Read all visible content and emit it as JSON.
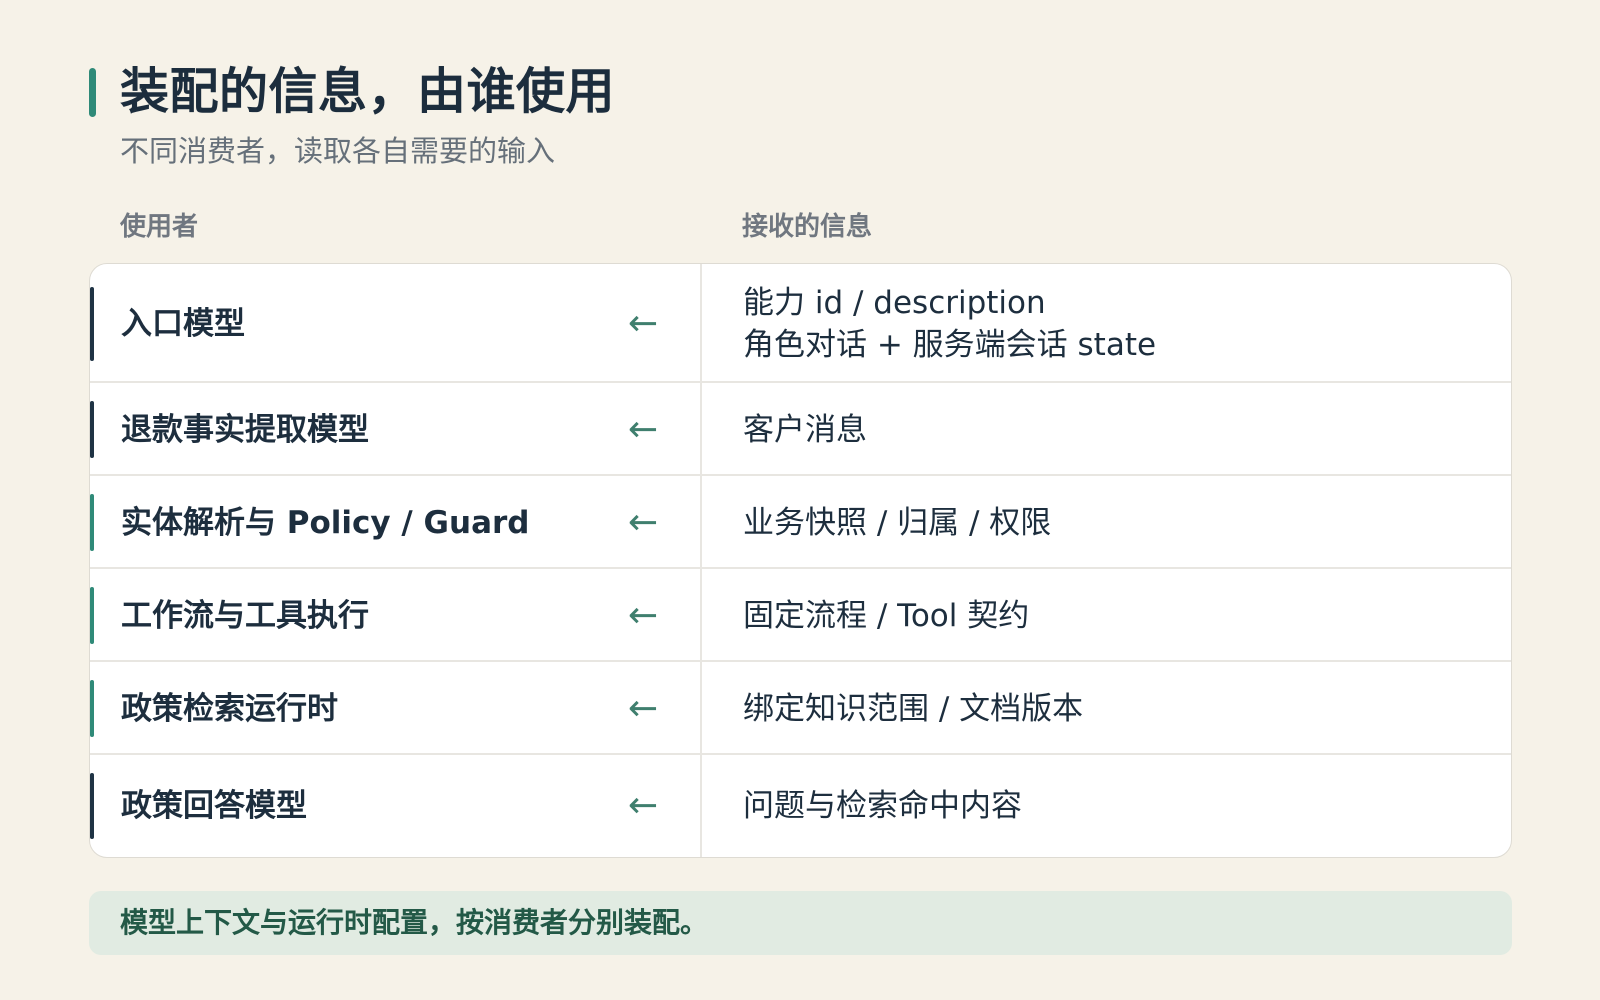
{
  "title": "装配的信息，由谁使用",
  "subtitle": "不同消费者，读取各自需要的输入",
  "columns": {
    "left": "使用者",
    "right": "接收的信息"
  },
  "arrow_symbol": "←",
  "colors": {
    "teal": "#2f8a78",
    "navy": "#1f3344",
    "arrow": "#3f7f6e",
    "footer_bg": "#e1ebe2",
    "footer_text": "#235947"
  },
  "rows": [
    {
      "consumer": "入口模型",
      "info_lines": [
        "能力 id / description",
        "角色对话 + 服务端会话 state"
      ],
      "accent": "navy"
    },
    {
      "consumer": "退款事实提取模型",
      "info_lines": [
        "客户消息"
      ],
      "accent": "navy"
    },
    {
      "consumer": "实体解析与 Policy / Guard",
      "info_lines": [
        "业务快照 / 归属 / 权限"
      ],
      "accent": "teal"
    },
    {
      "consumer": "工作流与工具执行",
      "info_lines": [
        "固定流程 / Tool 契约"
      ],
      "accent": "teal"
    },
    {
      "consumer": "政策检索运行时",
      "info_lines": [
        "绑定知识范围 / 文档版本"
      ],
      "accent": "teal"
    },
    {
      "consumer": "政策回答模型",
      "info_lines": [
        "问题与检索命中内容"
      ],
      "accent": "navy"
    }
  ],
  "footer": "模型上下文与运行时配置，按消费者分别装配。"
}
